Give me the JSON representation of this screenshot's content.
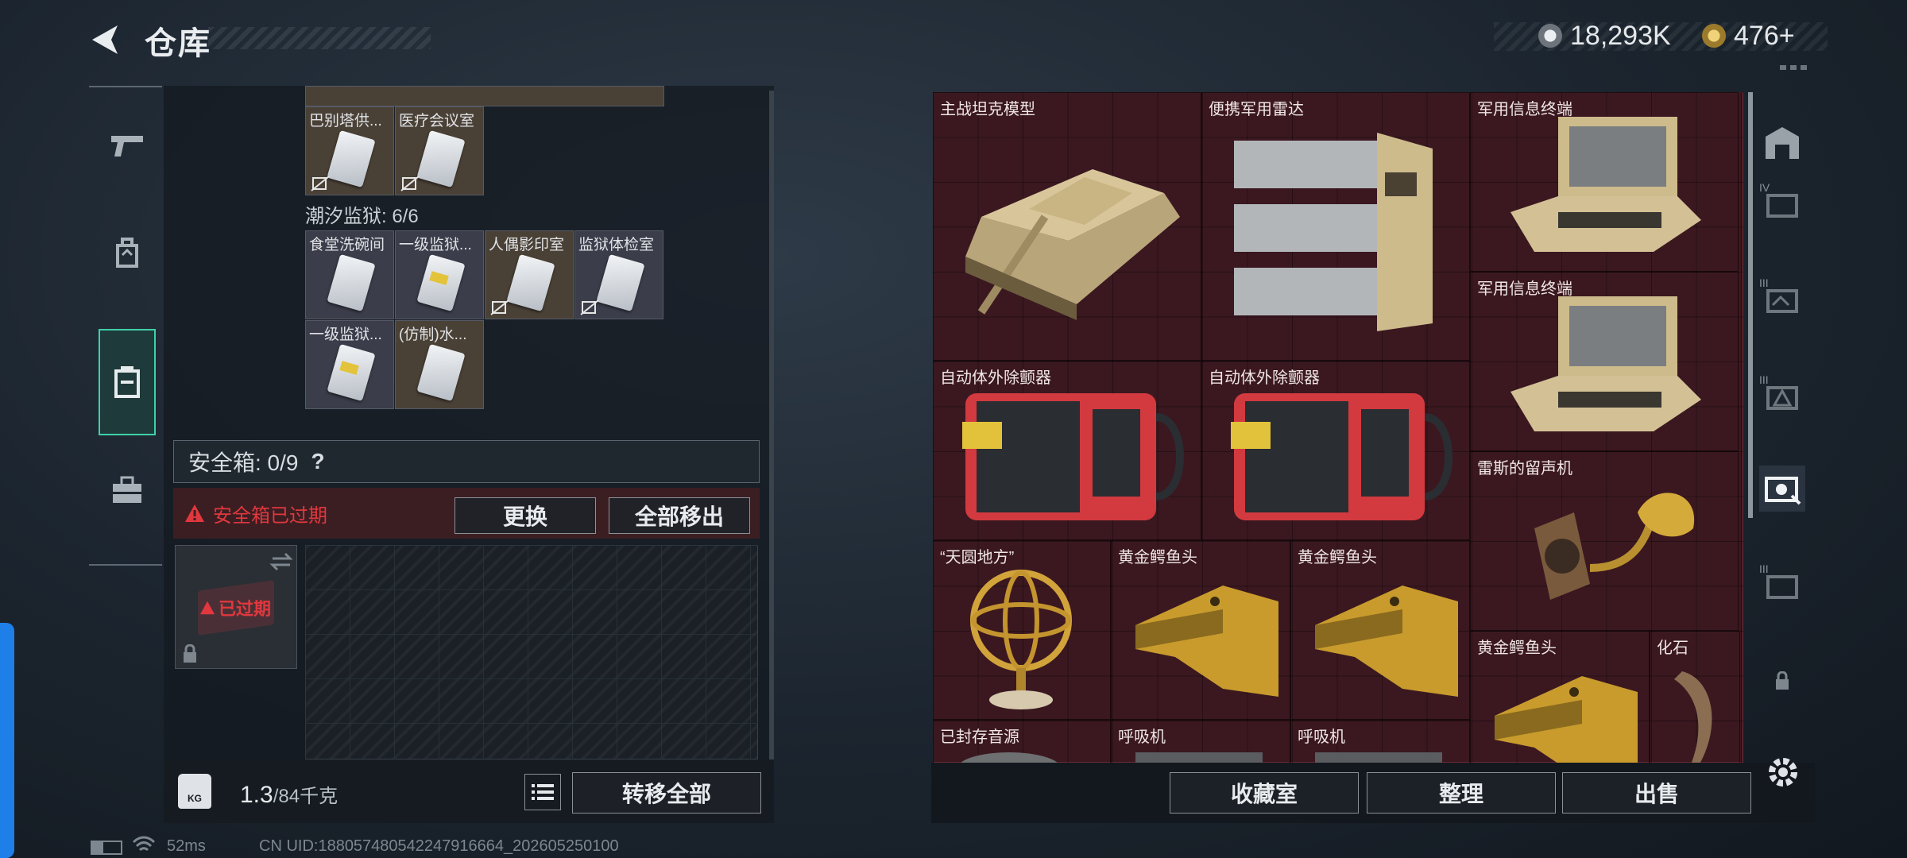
{
  "header": {
    "title": "仓库",
    "coins": "18,293K",
    "tokens": "476+"
  },
  "left_panel": {
    "top_row": [
      {
        "label": "巴别塔供...",
        "variant": "gold"
      },
      {
        "label": "医疗会议室",
        "variant": "gold"
      }
    ],
    "section_prison": "潮汐监狱: 6/6",
    "prison_cards": [
      {
        "label": "食堂洗碗间",
        "variant": "plain"
      },
      {
        "label": "一级监狱...",
        "variant": "plain",
        "yellow": true
      },
      {
        "label": "人偶影印室",
        "variant": "gold"
      },
      {
        "label": "监狱体检室",
        "variant": "plain"
      },
      {
        "label": "一级监狱...",
        "variant": "plain",
        "yellow": true
      },
      {
        "label": "(仿制)水...",
        "variant": "gold"
      }
    ],
    "safe_box_title": "安全箱: 0/9",
    "safe_box_help": "?",
    "expired_warning": "安全箱已过期",
    "replace_button": "更换",
    "remove_all_button": "全部移出",
    "expired_tag": "已过期",
    "weight_value": "1.3",
    "weight_max": "/84千克",
    "weight_icon_text": "KG",
    "transfer_all_button": "转移全部"
  },
  "right_panel": {
    "items": [
      {
        "label": "主战坦克模型",
        "icon": "tank-icon"
      },
      {
        "label": "便携军用雷达",
        "icon": "radar-icon"
      },
      {
        "label": "军用信息终端",
        "icon": "terminal-icon"
      },
      {
        "label": "军用信息终端",
        "icon": "terminal-icon"
      },
      {
        "label": "自动体外除颤器",
        "icon": "defibrillator-icon"
      },
      {
        "label": "自动体外除颤器",
        "icon": "defibrillator-icon"
      },
      {
        "label": "雷斯的留声机",
        "icon": "gramophone-icon"
      },
      {
        "label": "“天圆地方”",
        "icon": "armillary-icon"
      },
      {
        "label": "黄金鳄鱼头",
        "icon": "gold-croc-icon"
      },
      {
        "label": "黄金鳄鱼头",
        "icon": "gold-croc-icon"
      },
      {
        "label": "黄金鳄鱼头",
        "icon": "gold-croc-icon"
      },
      {
        "label": "化石",
        "icon": "fossil-icon"
      },
      {
        "label": "已封存音源",
        "icon": "audio-icon"
      },
      {
        "label": "呼吸机",
        "icon": "ventilator-icon"
      },
      {
        "label": "呼吸机",
        "icon": "ventilator-icon"
      }
    ],
    "collection_button": "收藏室",
    "sort_button": "整理",
    "sell_button": "出售",
    "tab_labels": [
      "IV",
      "III",
      "III",
      "III"
    ]
  },
  "status_bar": {
    "ping": "52ms",
    "uid": "CN UID:188057480542247916664_202605250100"
  },
  "colors": {
    "accent": "#3fd0a8",
    "danger": "#e0383e",
    "item_bg": "#3b1820"
  }
}
